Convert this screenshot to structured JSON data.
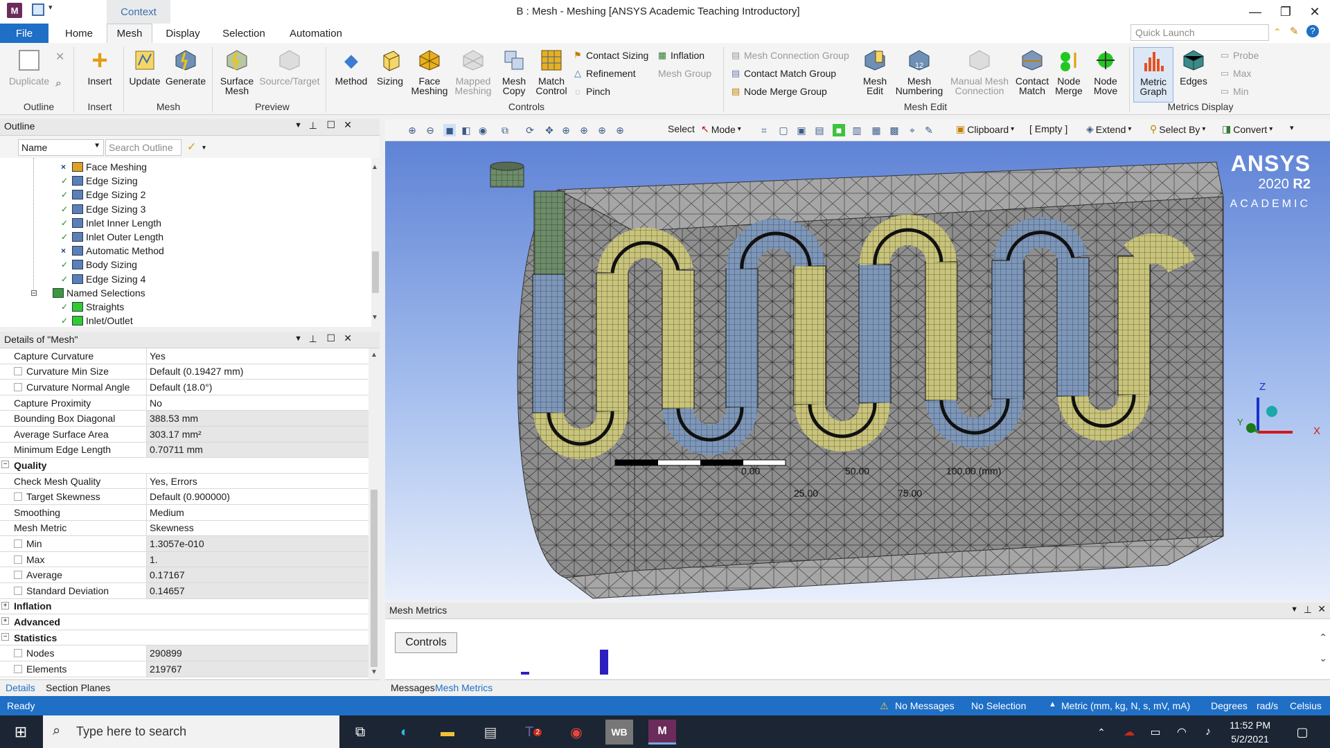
{
  "window": {
    "title": "B : Mesh - Meshing [ANSYS Academic Teaching Introductory]",
    "context_tab": "Context",
    "app_icon_letter": "M",
    "minimize": "—",
    "restore": "❐",
    "close": "✕"
  },
  "tabs": [
    "File",
    "Home",
    "Mesh",
    "Display",
    "Selection",
    "Automation"
  ],
  "quick_launch_placeholder": "Quick Launch",
  "ribbon": {
    "duplicate": "Duplicate",
    "insert": "Insert",
    "update": "Update",
    "generate": "Generate",
    "surface_mesh": "Surface Mesh",
    "source_target": "Source/Target",
    "method": "Method",
    "sizing": "Sizing",
    "face_meshing": "Face Meshing",
    "mapped_meshing": "Mapped Meshing",
    "mesh_copy": "Mesh Copy",
    "match_control": "Match Control",
    "contact_sizing": "Contact Sizing",
    "inflation": "Inflation",
    "refinement": "Refinement",
    "mesh_group": "Mesh Group",
    "pinch": "Pinch",
    "mesh_connection_group": "Mesh Connection Group",
    "contact_match_group": "Contact Match Group",
    "node_merge_group": "Node Merge Group",
    "mesh_edit": "Mesh Edit",
    "mesh_numbering": "Mesh Numbering",
    "manual_mesh_connection": "Manual Mesh Connection",
    "contact_match": "Contact Match",
    "node_merge": "Node Merge",
    "node_move": "Node Move",
    "metric_graph": "Metric Graph",
    "edges": "Edges",
    "probe": "Probe",
    "max": "Max",
    "min": "Min",
    "groups": {
      "outline": "Outline",
      "insert": "Insert",
      "mesh": "Mesh",
      "preview": "Preview",
      "controls": "Controls",
      "mesh_edit": "Mesh Edit",
      "metrics_display": "Metrics Display"
    }
  },
  "outline": {
    "title": "Outline",
    "name_select": "Name",
    "search_placeholder": "Search Outline",
    "items": [
      {
        "label": "Face Meshing",
        "status": "x"
      },
      {
        "label": "Edge Sizing",
        "status": "ok"
      },
      {
        "label": "Edge Sizing 2",
        "status": "ok"
      },
      {
        "label": "Edge Sizing 3",
        "status": "ok"
      },
      {
        "label": "Inlet Inner Length",
        "status": "ok"
      },
      {
        "label": "Inlet Outer Length",
        "status": "ok"
      },
      {
        "label": "Automatic Method",
        "status": "x"
      },
      {
        "label": "Body Sizing",
        "status": "ok"
      },
      {
        "label": "Edge Sizing 4",
        "status": "ok"
      },
      {
        "label": "Named Selections",
        "status": ""
      },
      {
        "label": "Straights",
        "status": "ok"
      },
      {
        "label": "Inlet/Outlet",
        "status": "ok"
      }
    ]
  },
  "details": {
    "title": "Details of \"Mesh\"",
    "rows": [
      {
        "label": "Capture Curvature",
        "value": "Yes",
        "chk": false,
        "gray": false
      },
      {
        "label": "Curvature Min Size",
        "value": "Default (0.19427 mm)",
        "chk": true,
        "gray": false
      },
      {
        "label": "Curvature Normal Angle",
        "value": "Default (18.0°)",
        "chk": true,
        "gray": false
      },
      {
        "label": "Capture Proximity",
        "value": "No",
        "chk": false,
        "gray": false
      },
      {
        "label": "Bounding Box Diagonal",
        "value": "388.53 mm",
        "chk": false,
        "gray": true
      },
      {
        "label": "Average Surface Area",
        "value": "303.17 mm²",
        "chk": false,
        "gray": true
      },
      {
        "label": "Minimum Edge Length",
        "value": "0.70711 mm",
        "chk": false,
        "gray": true
      },
      {
        "section": "Quality",
        "exp": "−"
      },
      {
        "label": "Check Mesh Quality",
        "value": "Yes, Errors",
        "chk": false,
        "gray": false
      },
      {
        "label": "Target Skewness",
        "value": "Default (0.900000)",
        "chk": true,
        "gray": false
      },
      {
        "label": "Smoothing",
        "value": "Medium",
        "chk": false,
        "gray": false
      },
      {
        "label": "Mesh Metric",
        "value": "Skewness",
        "chk": false,
        "gray": false
      },
      {
        "label": "Min",
        "value": "1.3057e-010",
        "chk": true,
        "gray": true
      },
      {
        "label": "Max",
        "value": "1.",
        "chk": true,
        "gray": true
      },
      {
        "label": "Average",
        "value": "0.17167",
        "chk": true,
        "gray": true
      },
      {
        "label": "Standard Deviation",
        "value": "0.14657",
        "chk": true,
        "gray": true
      },
      {
        "section": "Inflation",
        "exp": "+"
      },
      {
        "section": "Advanced",
        "exp": "+"
      },
      {
        "section": "Statistics",
        "exp": "−"
      },
      {
        "label": "Nodes",
        "value": "290899",
        "chk": true,
        "gray": true
      },
      {
        "label": "Elements",
        "value": "219767",
        "chk": true,
        "gray": true
      }
    ]
  },
  "left_tabs": [
    "Details",
    "Section Planes"
  ],
  "graphics_toolbar": {
    "select": "Select",
    "mode": "Mode",
    "clipboard": "Clipboard",
    "empty": "[ Empty ]",
    "extend": "Extend",
    "select_by": "Select By",
    "convert": "Convert"
  },
  "viewport": {
    "brand": "ANSYS",
    "version": "2020",
    "release": "R2",
    "edition": "ACADEMIC",
    "scale_top": [
      "0.00",
      "50.00",
      "100.00 (mm)"
    ],
    "scale_bottom": [
      "25.00",
      "75.00"
    ],
    "axis_z": "Z",
    "axis_x": "X",
    "axis_y": "Y"
  },
  "mesh_metrics": {
    "title": "Mesh Metrics",
    "controls_label": "Controls",
    "bars": [
      0.1,
      1.0
    ]
  },
  "bottom_tabs": [
    "Messages",
    "Mesh Metrics"
  ],
  "status": {
    "ready": "Ready",
    "messages": "No Messages",
    "selection": "No Selection",
    "units": "Metric (mm, kg, N, s, mV, mA)",
    "angle": "Degrees",
    "rate": "rad/s",
    "temp": "Celsius"
  },
  "taskbar": {
    "search_placeholder": "Type here to search",
    "time": "11:52 PM",
    "date": "5/2/2021",
    "wb": "WB",
    "m": "M",
    "teams_badge": "2"
  },
  "colors": {
    "accent": "#1f6fc6",
    "viewport_top": "#5f83d6",
    "mesh_blue": "#7e97b8",
    "mesh_yellow": "#c9c47c"
  }
}
